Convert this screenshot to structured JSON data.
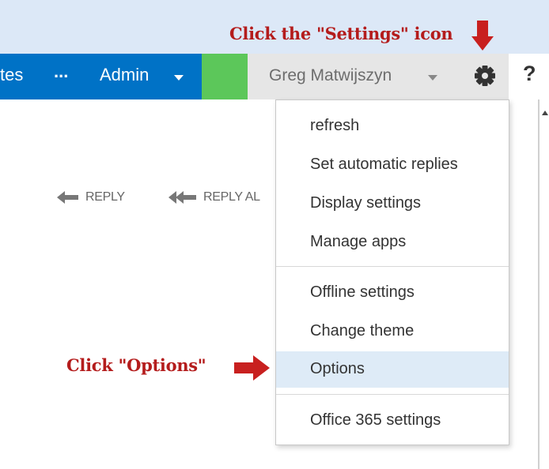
{
  "annotations": {
    "top": "Click the \"Settings\" icon",
    "bottom": "Click \"Options\""
  },
  "navbar": {
    "partial_item": "tes",
    "more": "...",
    "admin": "Admin",
    "user": "Greg Matwijszyn",
    "help": "?"
  },
  "actions": {
    "reply": "REPLY",
    "reply_all": "REPLY AL"
  },
  "menu": {
    "items": [
      {
        "label": "refresh"
      },
      {
        "label": "Set automatic replies"
      },
      {
        "label": "Display settings"
      },
      {
        "label": "Manage apps"
      },
      {
        "label": "Offline settings"
      },
      {
        "label": "Change theme"
      },
      {
        "label": "Options",
        "highlighted": true
      },
      {
        "label": "Office 365 settings"
      }
    ]
  },
  "colors": {
    "nav_blue": "#0072c6",
    "nav_green": "#5cc75a",
    "annotation_red": "#b41c1c",
    "highlight": "#deebf7"
  },
  "icons": [
    "arrow-down-icon",
    "chevron-down-icon",
    "gear-icon",
    "help-icon",
    "reply-arrow-icon",
    "reply-all-arrow-icon",
    "arrow-right-icon"
  ]
}
